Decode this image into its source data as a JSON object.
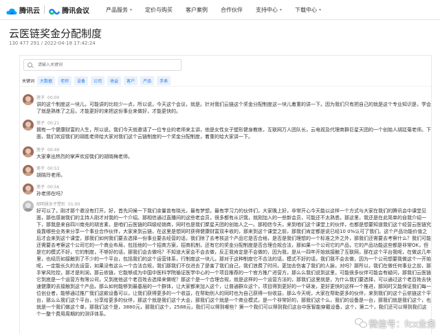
{
  "topbar": {
    "brand1": "腾讯云",
    "brand2": "腾讯会议",
    "nav": [
      "产品服务",
      "定价与购买",
      "客户案例",
      "合作伙伴",
      "支持中心",
      "下载中心"
    ]
  },
  "page": {
    "title": "云医链奖金分配制度",
    "meta": "130 477 291 / 2022-04-18 17:42:24"
  },
  "search": {
    "placeholder": "请输入关键词"
  },
  "keywords": {
    "label": "关键词",
    "tags": [
      "大数据",
      "老师",
      "设备",
      "公司",
      "收益",
      "客户",
      "产品",
      "手表"
    ]
  },
  "messages": [
    {
      "speaker": "莲子",
      "time": "00:00",
      "text": "讲的这个制度这一块儿，可能讲的比较少一点，所以说，今天这个会议，就是。针对我们云链这个奖金分配制度这一块儿着重的讲一下。因为我们只有把自己的就是这个专业知识是，学会了就是熟练了之后，才能更好的来把这份事业来做好，才能更快的。"
    },
    {
      "speaker": "莲子",
      "time": "00:21",
      "text": "拥有一个健康财富的人生，所以说，我们今天就邀请了一位专业的老师来主讲，他是女性女子塑形健身教练，互联网万人团队长，云电视及代理商群巨星天团的一个创始人胡廷菊老师。下面，我们欢迎我们的胡胜老师给大家对我们这个云链制度的一个奖金分配制度，着重的给大家讲一下。"
    },
    {
      "speaker": "莲子",
      "time": "00:49",
      "text": "大家拿出热烈的掌声欢迎我们的胡晓梅老师。"
    },
    {
      "speaker": "莲子",
      "time": "00:53",
      "text": "胡晓玲老师。"
    },
    {
      "speaker": "莲子",
      "time": "00:56",
      "text": "孙老师在吗？"
    },
    {
      "speaker": "胡明慧女子塑形",
      "time": "01:00",
      "text": "好可以了，刚才那个邀没有打开。好，首先问候一下我们余量曾有晓光，最有梦想，最有学习力的伙伴们，大家晚上好，非常开心今天能以这样一个方式与大家在我们的腾讯会中课堂见面，那也感谢我们的主持人刚才对我的一个介绍。那相信通过直播间的这些老会员，很多都有从识我，就刚加入的一些新会员，可能还不太熟悉，那这里，我还是在此简单的自我介绍一下，那我是来自四川南充的胡言素，是咱们云医链的四级经销商，同时也是我们聚星天团的创始人之一。那相信今天，来到咱们这个课堂上的伙伴，也都是想要知道我们这个经营云医链究竟靠哪些业务来分享一个事业合作伙伴，大家来到云链，在这里是想同时获得健康财富双丰收的，那来到这个课堂之前，那我们肯定都是说已经10 0%认可了我们。这个产品功能价值之后才会来到这个课堂，那我们如何我们要去选择一份事业要去经营的话，我们除了去考核这个产品它是否合格，是否是我们理想的一个标准之外之外，那我们还需要去考察什么？我们可能还需要去考察这个公司它的一个商业布局，包括他的一个招商方案，招商机制，还有它的奖金分配制度是否合理合规合法，那如果一个公司它的产品，它的产品功能这些都是非常OK，但是它的模式不好，它的制度，不够好的话，那我们会去做吗？不知道大家会不会去做，反正我肯定是不会做的，因为我，是从一四年开始就接触了互联网，那在这个平台我呢，在做这几年里，也经历如接触到了不少的一个平台，包括我们的这个运营体系，行制度这一块儿，那对于这种制度它不合法的话，模式不好的话，我们我不会去做，因为一个公司想要我做这个一开始呢，一定能长久的去运营，如果没有这么一个合法合规，我们那我们不仅进去了是害了我们自己，我们浪费了时间，更加去伤害了我们的人脉，对吗？那所以，我们在做任何事业之前，那手掌风险控，那才是利润，那云依链，它能够成为中国中医科学院循证医学中心的一个项目推荐的一个官方推广进营方，那么么我们说到这里，可能很多伙伴可能会有疑问，那我们云医链它到底是一个运营方有限公司，又到底他这个老百姓去选择来做呢？那这个是一个合理合规，就是这样的一个运营方法的，那我们这里就是，为什么我们要选择，可以通过这个老百姓去快速健康的去接触到这个产品，那么如何能够到最基层的一个群体，让大家都来加入这个，让普通群众这个，项目得到更好的一个研发，更好更快的这样一个推进，那同时又能保证我们每一位创业者，能够通过推广我们这款设备可以，让我们获得更多的一个收益，在帮助别人的同时也为自己获得一份收益，那么今天呢，大家在帮助更多的伙伴，来到我们的这个云依链这个平台，那么么我们这个平台，分享给更多的伙伴，那这个就是我们这个大会，那我们这个就是一个商业模式，是一个非常好的，那我们这个么，我们的设备是一台，那我们就是我们这个，也就是一个我们做这个单，那我们这个是，3880元，那我们这个，2588元，我们可以得到哪些？第一个我们可以得到我们这台中医智能穿戴设备，这个，第二个，我们还可以得到我们这个一整个费用周期的的测评体系。"
    }
  ],
  "watermark": "微信号：fcx业务"
}
